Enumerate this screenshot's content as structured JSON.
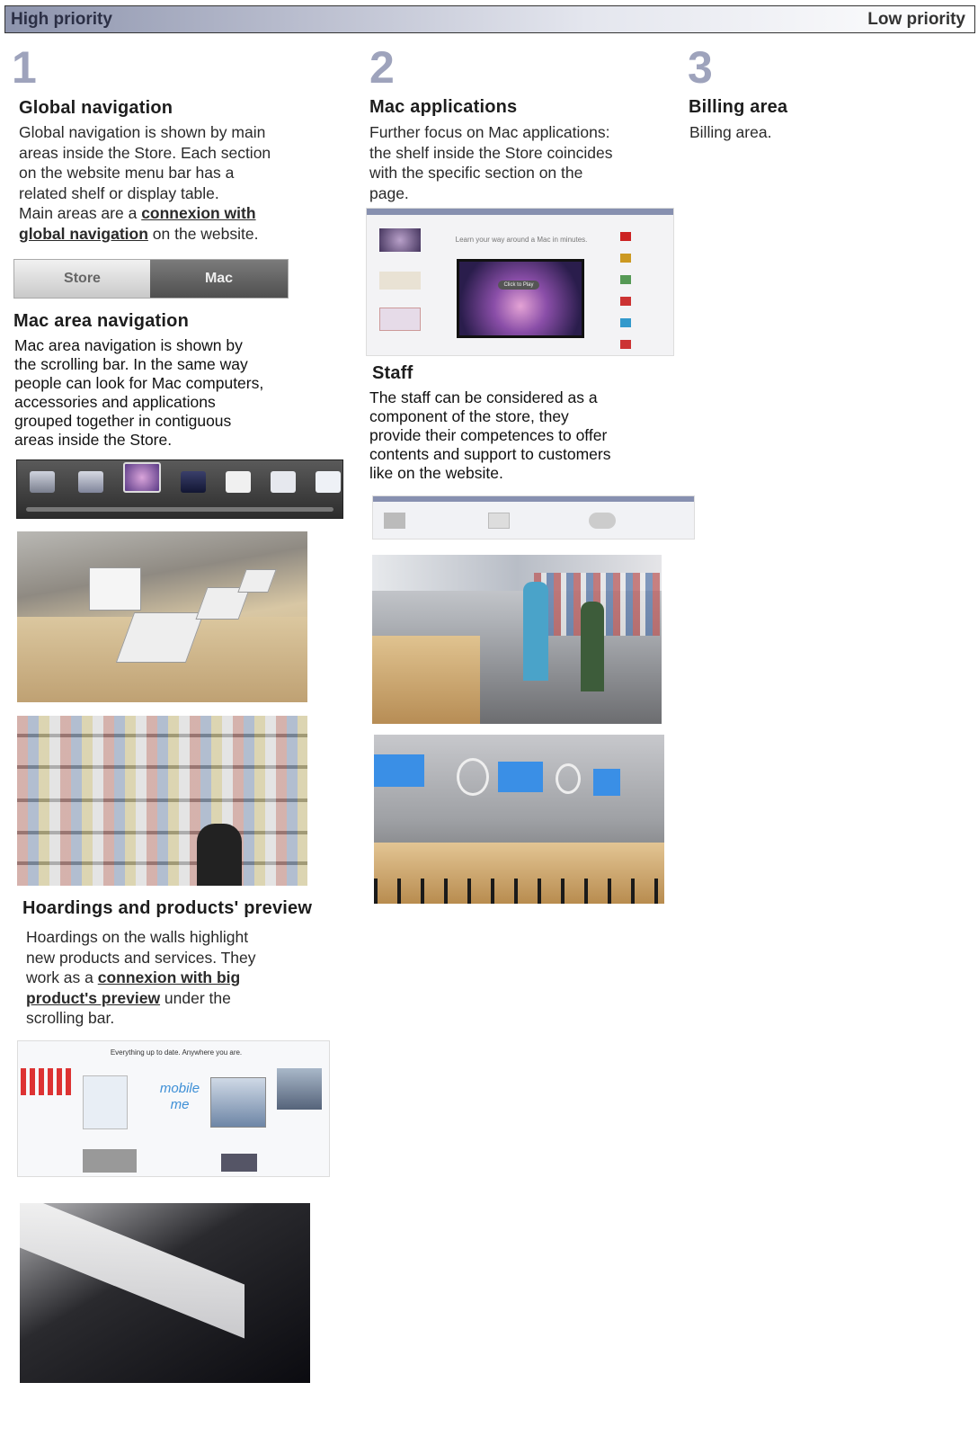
{
  "priority_bar": {
    "high": "High priority",
    "low": "Low priority"
  },
  "col1": {
    "number": "1",
    "global_title": "Global navigation",
    "global_lines": [
      "Global navigation is shown by main",
      "areas inside the Store. Each section",
      "on the website menu bar has a",
      "related shelf or display table.",
      "Main areas are a "
    ],
    "global_link1": "connexion with",
    "global_link2": "global navigation",
    "global_tail": " on the website.",
    "tabs": [
      "Store",
      "Mac"
    ],
    "mac_title": "Mac area navigation",
    "mac_lines": [
      "Mac area navigation is shown by",
      "the scrolling bar. In the same way",
      "people can look for Mac computers,",
      "accessories and applications",
      "grouped together in contiguous",
      "areas inside the Store."
    ],
    "hoard_title": "Hoardings and products' preview",
    "hoard_lines": [
      "Hoardings on the walls highlight",
      "new products and services. They",
      "work as a "
    ],
    "hoard_link1": "connexion with big",
    "hoard_link2": "product's preview",
    "hoard_tail": " under the",
    "hoard_last": "scrolling bar.",
    "preview_banner": "Everything up to date. Anywhere you are.",
    "preview_logo": "mobile me"
  },
  "col2": {
    "number": "2",
    "apps_title": "Mac applications",
    "apps_lines": [
      "Further focus on Mac applications:",
      "the shelf inside the Store coincides",
      "with the specific section on the",
      "page."
    ],
    "apps_tagline": "Learn your way around a Mac in minutes.",
    "apps_button": "Click to Play",
    "staff_title": "Staff",
    "staff_lines": [
      "The staff can be considered as a",
      "component of the store, they",
      "provide their competences to offer",
      "contents and support to customers",
      "like on the website."
    ]
  },
  "col3": {
    "number": "3",
    "billing_title": "Billing area",
    "billing_text": "Billing area."
  }
}
